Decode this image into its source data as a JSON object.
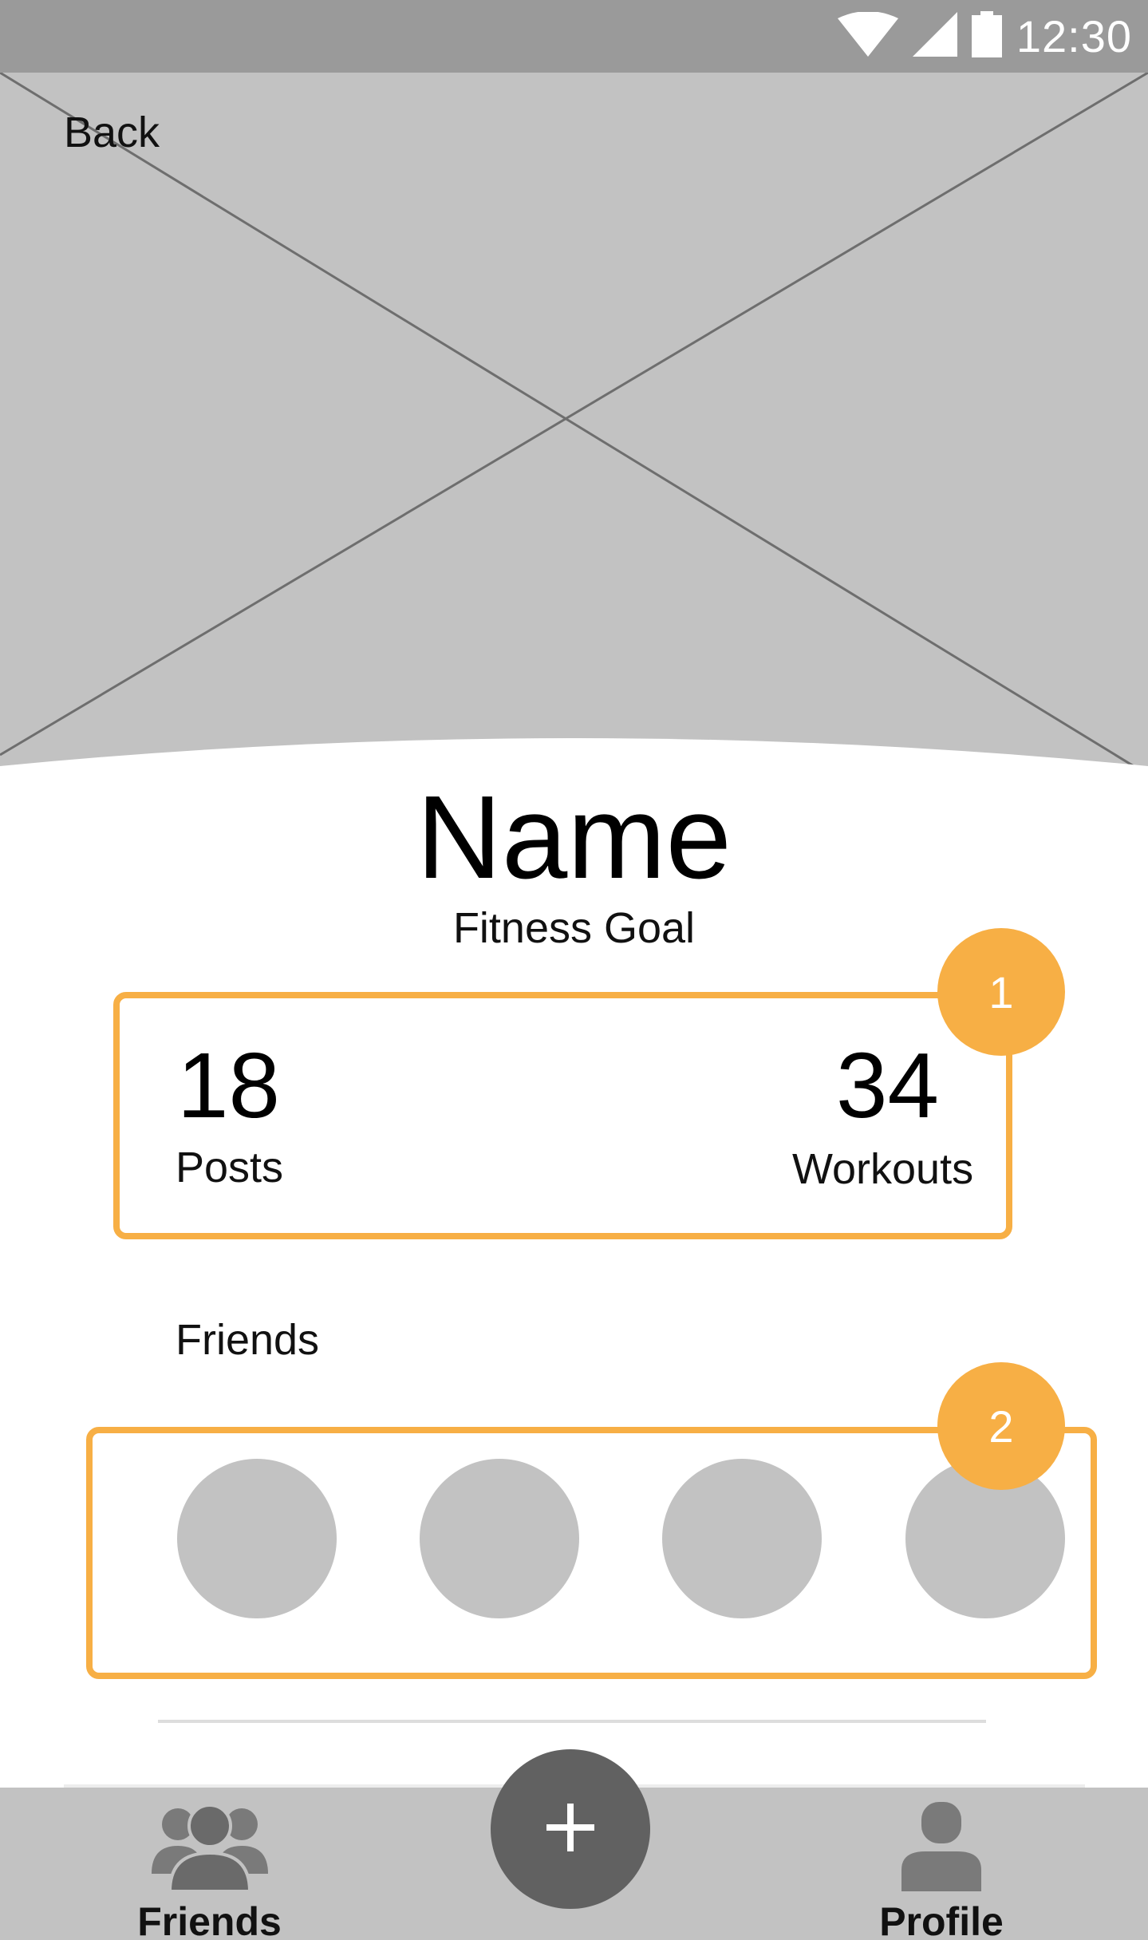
{
  "status_bar": {
    "time": "12:30",
    "icons": [
      "wifi-icon",
      "cell-signal-icon",
      "battery-icon"
    ]
  },
  "header": {
    "back_label": "Back"
  },
  "profile": {
    "name": "Name",
    "fitness_goal": "Fitness Goal"
  },
  "stats": {
    "posts_value": "18",
    "posts_label": "Posts",
    "workouts_value": "34",
    "workouts_label": "Workouts",
    "badge": "1"
  },
  "friends": {
    "heading": "Friends",
    "badge": "2",
    "avatar_count": 4
  },
  "bottom_nav": {
    "friends_label": "Friends",
    "profile_label": "Profile",
    "fab_icon": "plus-icon"
  },
  "colors": {
    "accent": "#f7af45",
    "placeholder": "#c2c2c2",
    "status_bar": "#9a9a9a",
    "fab": "#616161"
  }
}
